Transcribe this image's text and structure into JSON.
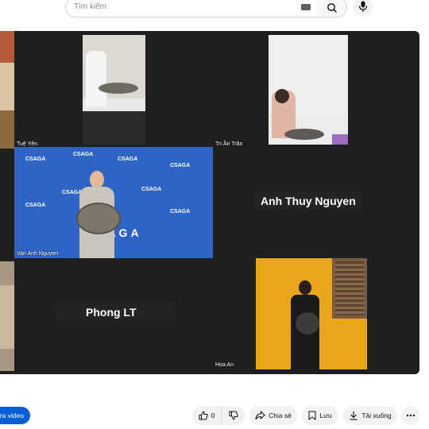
{
  "search": {
    "placeholder": "Tìm kiếm"
  },
  "participants": {
    "tue_yen": "Tuệ Yên",
    "tri_an_tran": "Tri Ân Trần",
    "anh_thuy": "Anh Thuy Nguyen",
    "van_anh": "Van Anh Nguyen",
    "phong": "Phong LT",
    "hoa_an": "Hoa An"
  },
  "banner": {
    "logo_text": "CSAGA"
  },
  "actions": {
    "subscribe_label": "ra video",
    "like_count": "0",
    "share_label": "Chia sẻ",
    "save_label": "Lưu",
    "download_label": "Tải xuống"
  },
  "icons": [
    "keyboard-icon",
    "search-icon",
    "mic-icon",
    "thumbs-up-icon",
    "thumbs-down-icon",
    "share-icon",
    "bookmark-icon",
    "download-icon",
    "more-icon"
  ],
  "colors": {
    "subscribe_bg": "#065fd4",
    "tile_blue": "#2f64c5",
    "tile_yellow": "#e7a61c",
    "player_bg": "#1f1f1f"
  }
}
